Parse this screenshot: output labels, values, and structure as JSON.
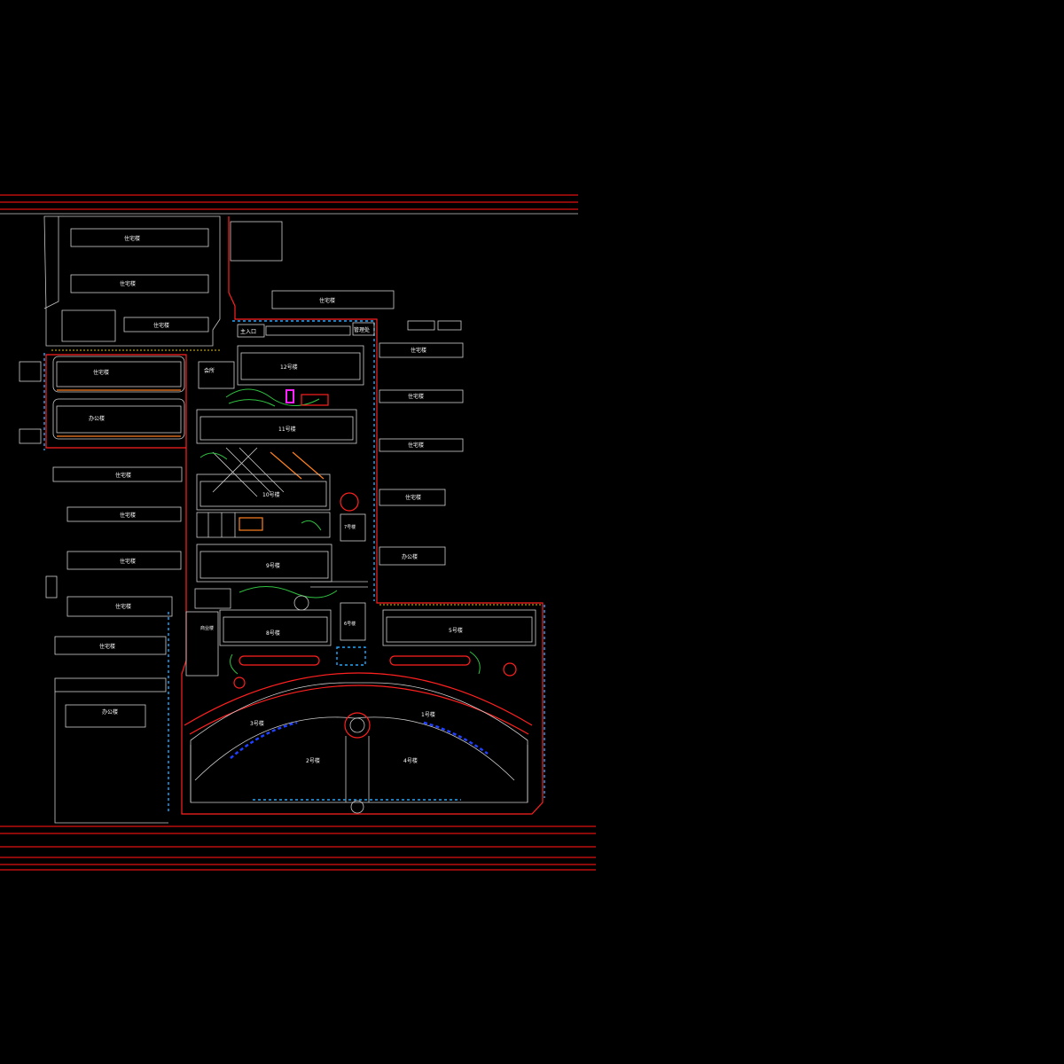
{
  "colors": {
    "background": "#000000",
    "road": "#e01010",
    "building": "#cfcfcf",
    "landscape": "#30c040",
    "water": "#20a8ff",
    "accent": "#ff20ff"
  },
  "labels": {
    "north_entrance": "主入口",
    "north_gate": "管理处",
    "clubhouse": "会所",
    "bldg_12": "12号楼",
    "bldg_11": "11号楼",
    "bldg_10": "10号楼",
    "bldg_9": "9号楼",
    "bldg_8": "8号楼",
    "bldg_7": "7号楼",
    "bldg_6": "6号楼",
    "bldg_5": "5号楼",
    "bldg_4": "4号楼",
    "bldg_3": "3号楼",
    "bldg_2": "2号楼",
    "bldg_1": "1号楼",
    "west_a": "住宅楼",
    "west_b": "住宅楼",
    "west_c": "住宅楼",
    "west_d": "住宅楼",
    "west_e": "住宅楼",
    "west_f": "住宅楼",
    "west_g": "办公楼",
    "nw_a": "住宅楼",
    "nw_b": "住宅楼",
    "nw_c": "住宅楼",
    "n_block": "住宅楼",
    "east_a": "住宅楼",
    "east_b": "住宅楼",
    "east_c": "住宅楼",
    "east_d": "住宅楼",
    "east_e": "办公楼",
    "commercial": "商业楼",
    "sw_office": "办公楼"
  }
}
